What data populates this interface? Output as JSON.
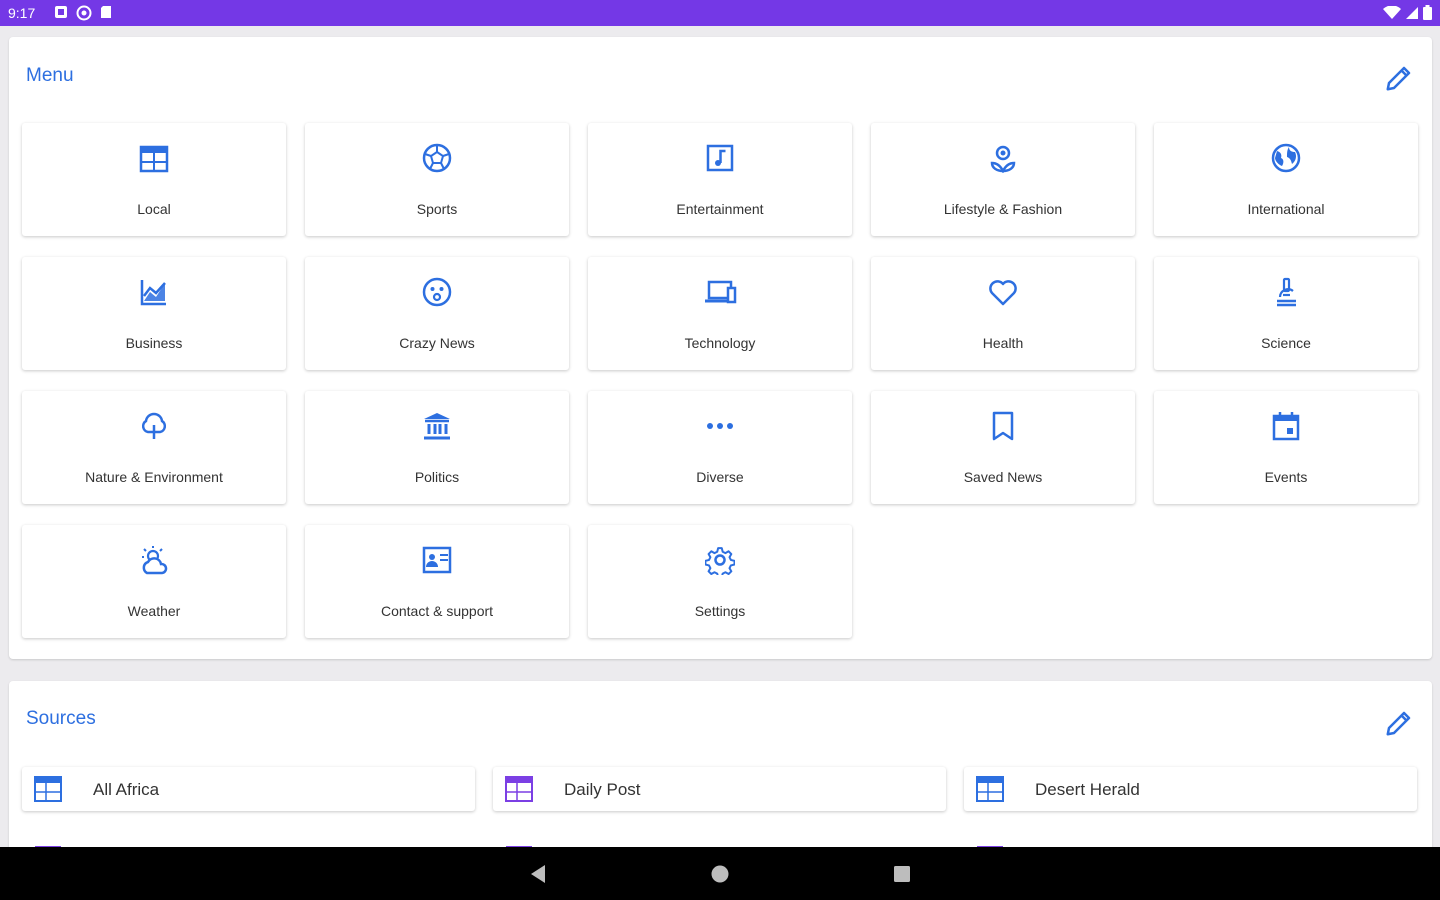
{
  "status_bar": {
    "time": "9:17",
    "left_icons": [
      "notification-icon",
      "at-sign-icon",
      "sd-card-icon"
    ],
    "right_icons": [
      "wifi-icon",
      "cellular-signal-icon",
      "battery-icon"
    ],
    "color": "#7438e6"
  },
  "menu": {
    "title": "Menu",
    "items": [
      {
        "label": "Local",
        "icon": "newspaper-icon"
      },
      {
        "label": "Sports",
        "icon": "soccer-ball-icon"
      },
      {
        "label": "Entertainment",
        "icon": "music-note-icon"
      },
      {
        "label": "Lifestyle & Fashion",
        "icon": "flower-icon"
      },
      {
        "label": "International",
        "icon": "globe-icon"
      },
      {
        "label": "Business",
        "icon": "chart-line-icon"
      },
      {
        "label": "Crazy News",
        "icon": "surprised-face-icon"
      },
      {
        "label": "Technology",
        "icon": "devices-icon"
      },
      {
        "label": "Health",
        "icon": "heart-icon"
      },
      {
        "label": "Science",
        "icon": "microscope-icon"
      },
      {
        "label": "Nature & Environment",
        "icon": "tree-icon"
      },
      {
        "label": "Politics",
        "icon": "bank-building-icon"
      },
      {
        "label": "Diverse",
        "icon": "more-dots-icon"
      },
      {
        "label": "Saved News",
        "icon": "bookmark-icon"
      },
      {
        "label": "Events",
        "icon": "calendar-icon"
      },
      {
        "label": "Weather",
        "icon": "weather-sun-cloud-icon"
      },
      {
        "label": "Contact & support",
        "icon": "contact-card-icon"
      },
      {
        "label": "Settings",
        "icon": "gear-icon"
      }
    ]
  },
  "sources": {
    "title": "Sources",
    "items": [
      {
        "label": "All Africa",
        "icon": "source-blue-icon"
      },
      {
        "label": "Daily Post",
        "icon": "source-purple-icon"
      },
      {
        "label": "Desert Herald",
        "icon": "source-blue-icon"
      }
    ]
  },
  "colors": {
    "accent": "#2d6fe0",
    "status_bar": "#7438e6",
    "source_purple": "#7b3fe4",
    "background": "#ecebee"
  }
}
